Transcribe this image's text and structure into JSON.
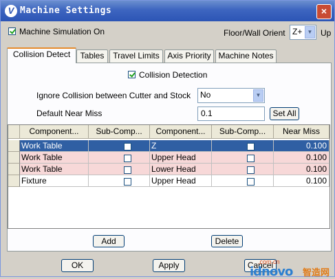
{
  "window": {
    "title": "Machine Settings",
    "logo": "V",
    "close": "×"
  },
  "top": {
    "machine_sim_label": "Machine Simulation On",
    "machine_sim_checked": true,
    "floor_label": "Floor/Wall Orient",
    "floor_value": "Z+",
    "up_label": "Up"
  },
  "tabs": [
    {
      "label": "Collision Detect",
      "active": true
    },
    {
      "label": "Tables"
    },
    {
      "label": "Travel Limits"
    },
    {
      "label": "Axis Priority"
    },
    {
      "label": "Machine Notes"
    }
  ],
  "collision": {
    "label": "Collision Detection",
    "checked": true,
    "ignore_label": "Ignore Collision between Cutter and Stock",
    "ignore_value": "No",
    "near_miss_label": "Default Near Miss",
    "near_miss_value": "0.1",
    "set_all": "Set All"
  },
  "table": {
    "headers": [
      "Component...",
      "Sub-Comp...",
      "Component...",
      "Sub-Comp...",
      "Near Miss"
    ],
    "rows": [
      {
        "c1": "Work Table",
        "c2": "Z",
        "near": "0.100",
        "style": "selected"
      },
      {
        "c1": "Work Table",
        "c2": "Upper Head",
        "near": "0.100",
        "style": "pink"
      },
      {
        "c1": "Work Table",
        "c2": "Lower Head",
        "near": "0.100",
        "style": "pink"
      },
      {
        "c1": "Fixture",
        "c2": "Upper Head",
        "near": "0.100",
        "style": "white"
      }
    ]
  },
  "buttons": {
    "add": "Add",
    "delete": "Delete",
    "ok": "OK",
    "apply": "Apply",
    "cancel": "Cancel"
  },
  "watermark": {
    "small": ".com.cn",
    "big": "idnovo",
    "cn": "智造网"
  },
  "colors": {
    "title_bar": "#2c55b5",
    "selected_row": "#2f5fa3",
    "pink_row": "#f7d8d8",
    "tab_accent": "#e68b2c"
  }
}
